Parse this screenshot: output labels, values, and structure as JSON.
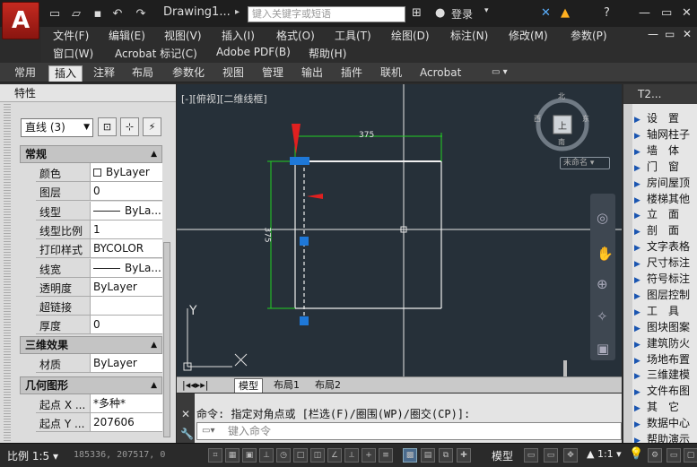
{
  "app": {
    "logo": "A",
    "doc_title": "Drawing1...",
    "search_placeholder": "键入关键字或短语",
    "login": "登录"
  },
  "menu": [
    "文件(F)",
    "编辑(E)",
    "视图(V)",
    "插入(I)",
    "格式(O)",
    "工具(T)",
    "绘图(D)",
    "标注(N)",
    "修改(M)",
    "参数(P)",
    "窗口(W)",
    "Acrobat 标记(C)",
    "Adobe PDF(B)",
    "帮助(H)"
  ],
  "ribbon_tabs": [
    "常用",
    "插入",
    "注释",
    "布局",
    "参数化",
    "视图",
    "管理",
    "输出",
    "插件",
    "联机",
    "Acrobat"
  ],
  "ribbon_active": "插入",
  "properties": {
    "title": "特性",
    "selection": "直线 (3)",
    "sections": {
      "general": "常规",
      "effects": "三维效果",
      "geometry": "几何图形"
    },
    "general_rows": [
      {
        "k": "颜色",
        "v": "ByLayer"
      },
      {
        "k": "图层",
        "v": "0"
      },
      {
        "k": "线型",
        "v": "ByLa..."
      },
      {
        "k": "线型比例",
        "v": "1"
      },
      {
        "k": "打印样式",
        "v": "BYCOLOR"
      },
      {
        "k": "线宽",
        "v": "ByLa..."
      },
      {
        "k": "透明度",
        "v": "ByLayer"
      },
      {
        "k": "超链接",
        "v": ""
      },
      {
        "k": "厚度",
        "v": "0"
      }
    ],
    "effects_rows": [
      {
        "k": "材质",
        "v": "ByLayer"
      }
    ],
    "geometry_rows": [
      {
        "k": "起点 X ...",
        "v": "*多种*"
      },
      {
        "k": "起点 Y ...",
        "v": "207606"
      }
    ]
  },
  "canvas": {
    "view_label": "[-][俯视][二维线框]",
    "dim_horizontal": "375",
    "dim_vertical": "375",
    "viewcube": {
      "north": "北",
      "south": "南",
      "west": "西",
      "east": "东",
      "face": "上"
    },
    "ucs_name": "未命名",
    "ucs_y": "Y"
  },
  "layout_tabs": [
    "模型",
    "布局1",
    "布局2"
  ],
  "layout_active": "模型",
  "command": {
    "history": "命令: 指定对角点或 [栏选(F)/圈围(WP)/圈交(CP)]:",
    "placeholder": "键入命令"
  },
  "tool_palette": {
    "title": "T2...",
    "items": [
      "设　置",
      "轴网柱子",
      "墙　体",
      "门　窗",
      "房间屋顶",
      "楼梯其他",
      "立　面",
      "剖　面",
      "文字表格",
      "尺寸标注",
      "符号标注",
      "图层控制",
      "工　具",
      "图块图案",
      "建筑防火",
      "场地布置",
      "三维建模",
      "文件布图",
      "其　它",
      "数据中心",
      "帮助演示"
    ]
  },
  "status": {
    "scale": "比例 1:5",
    "coords": "185336, 207517, 0",
    "model": "模型",
    "annotation_scale": "1:1"
  },
  "colors": {
    "canvas_bg": "#263039",
    "grip_blue": "#1e78d8",
    "dim_green": "#22d022",
    "arrow_red": "#e02020"
  }
}
